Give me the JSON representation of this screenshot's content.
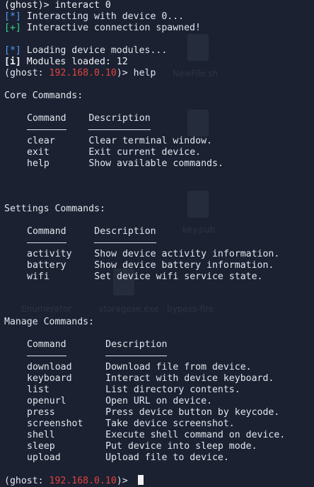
{
  "session": [
    {
      "type": "plain",
      "text": "(ghost)> interact 0"
    },
    {
      "type": "info",
      "tag": "[*]",
      "text": " Interacting with device 0..."
    },
    {
      "type": "ok",
      "tag": "[+]",
      "text": " Interactive connection spawned!"
    },
    {
      "type": "blank"
    },
    {
      "type": "info",
      "tag": "[*]",
      "text": " Loading device modules..."
    },
    {
      "type": "bold",
      "tag": "[i]",
      "text": " Modules loaded: 12"
    },
    {
      "type": "prompt",
      "cmd": "help"
    },
    {
      "type": "blank"
    }
  ],
  "prompt": {
    "open": "(ghost: ",
    "ip": "192.168.0.10",
    "close": ")> "
  },
  "command_header": "Command",
  "description_header": "Description",
  "sections": [
    {
      "title": "Core Commands:",
      "col": 11,
      "commands": [
        {
          "name": "clear",
          "desc": "Clear terminal window."
        },
        {
          "name": "exit",
          "desc": "Exit current device."
        },
        {
          "name": "help",
          "desc": "Show available commands."
        }
      ]
    },
    {
      "title": "Settings Commands:",
      "col": 12,
      "commands": [
        {
          "name": "activity",
          "desc": "Show device activity information."
        },
        {
          "name": "battery",
          "desc": "Show device battery information."
        },
        {
          "name": "wifi",
          "desc": "Set device wifi service state."
        }
      ]
    },
    {
      "title": "Manage Commands:",
      "col": 14,
      "commands": [
        {
          "name": "download",
          "desc": "Download file from device."
        },
        {
          "name": "keyboard",
          "desc": "Interact with device keyboard."
        },
        {
          "name": "list",
          "desc": "List directory contents."
        },
        {
          "name": "openurl",
          "desc": "Open URL on device."
        },
        {
          "name": "press",
          "desc": "Press device button by keycode."
        },
        {
          "name": "screenshot",
          "desc": "Take device screenshot."
        },
        {
          "name": "shell",
          "desc": "Execute shell command on device."
        },
        {
          "name": "sleep",
          "desc": "Put device into sleep mode."
        },
        {
          "name": "upload",
          "desc": "Upload file to device."
        }
      ]
    }
  ],
  "desktop_ghosts": [
    "NewFile.sh",
    "key.pub",
    "Enumerator",
    "storagexe.exe",
    "bypass-fire"
  ],
  "colors": {
    "background": "#1b2131",
    "info": "#4f9cf7",
    "ok": "#35d488",
    "ip": "#e0433c",
    "text": "#e2e6ee"
  }
}
